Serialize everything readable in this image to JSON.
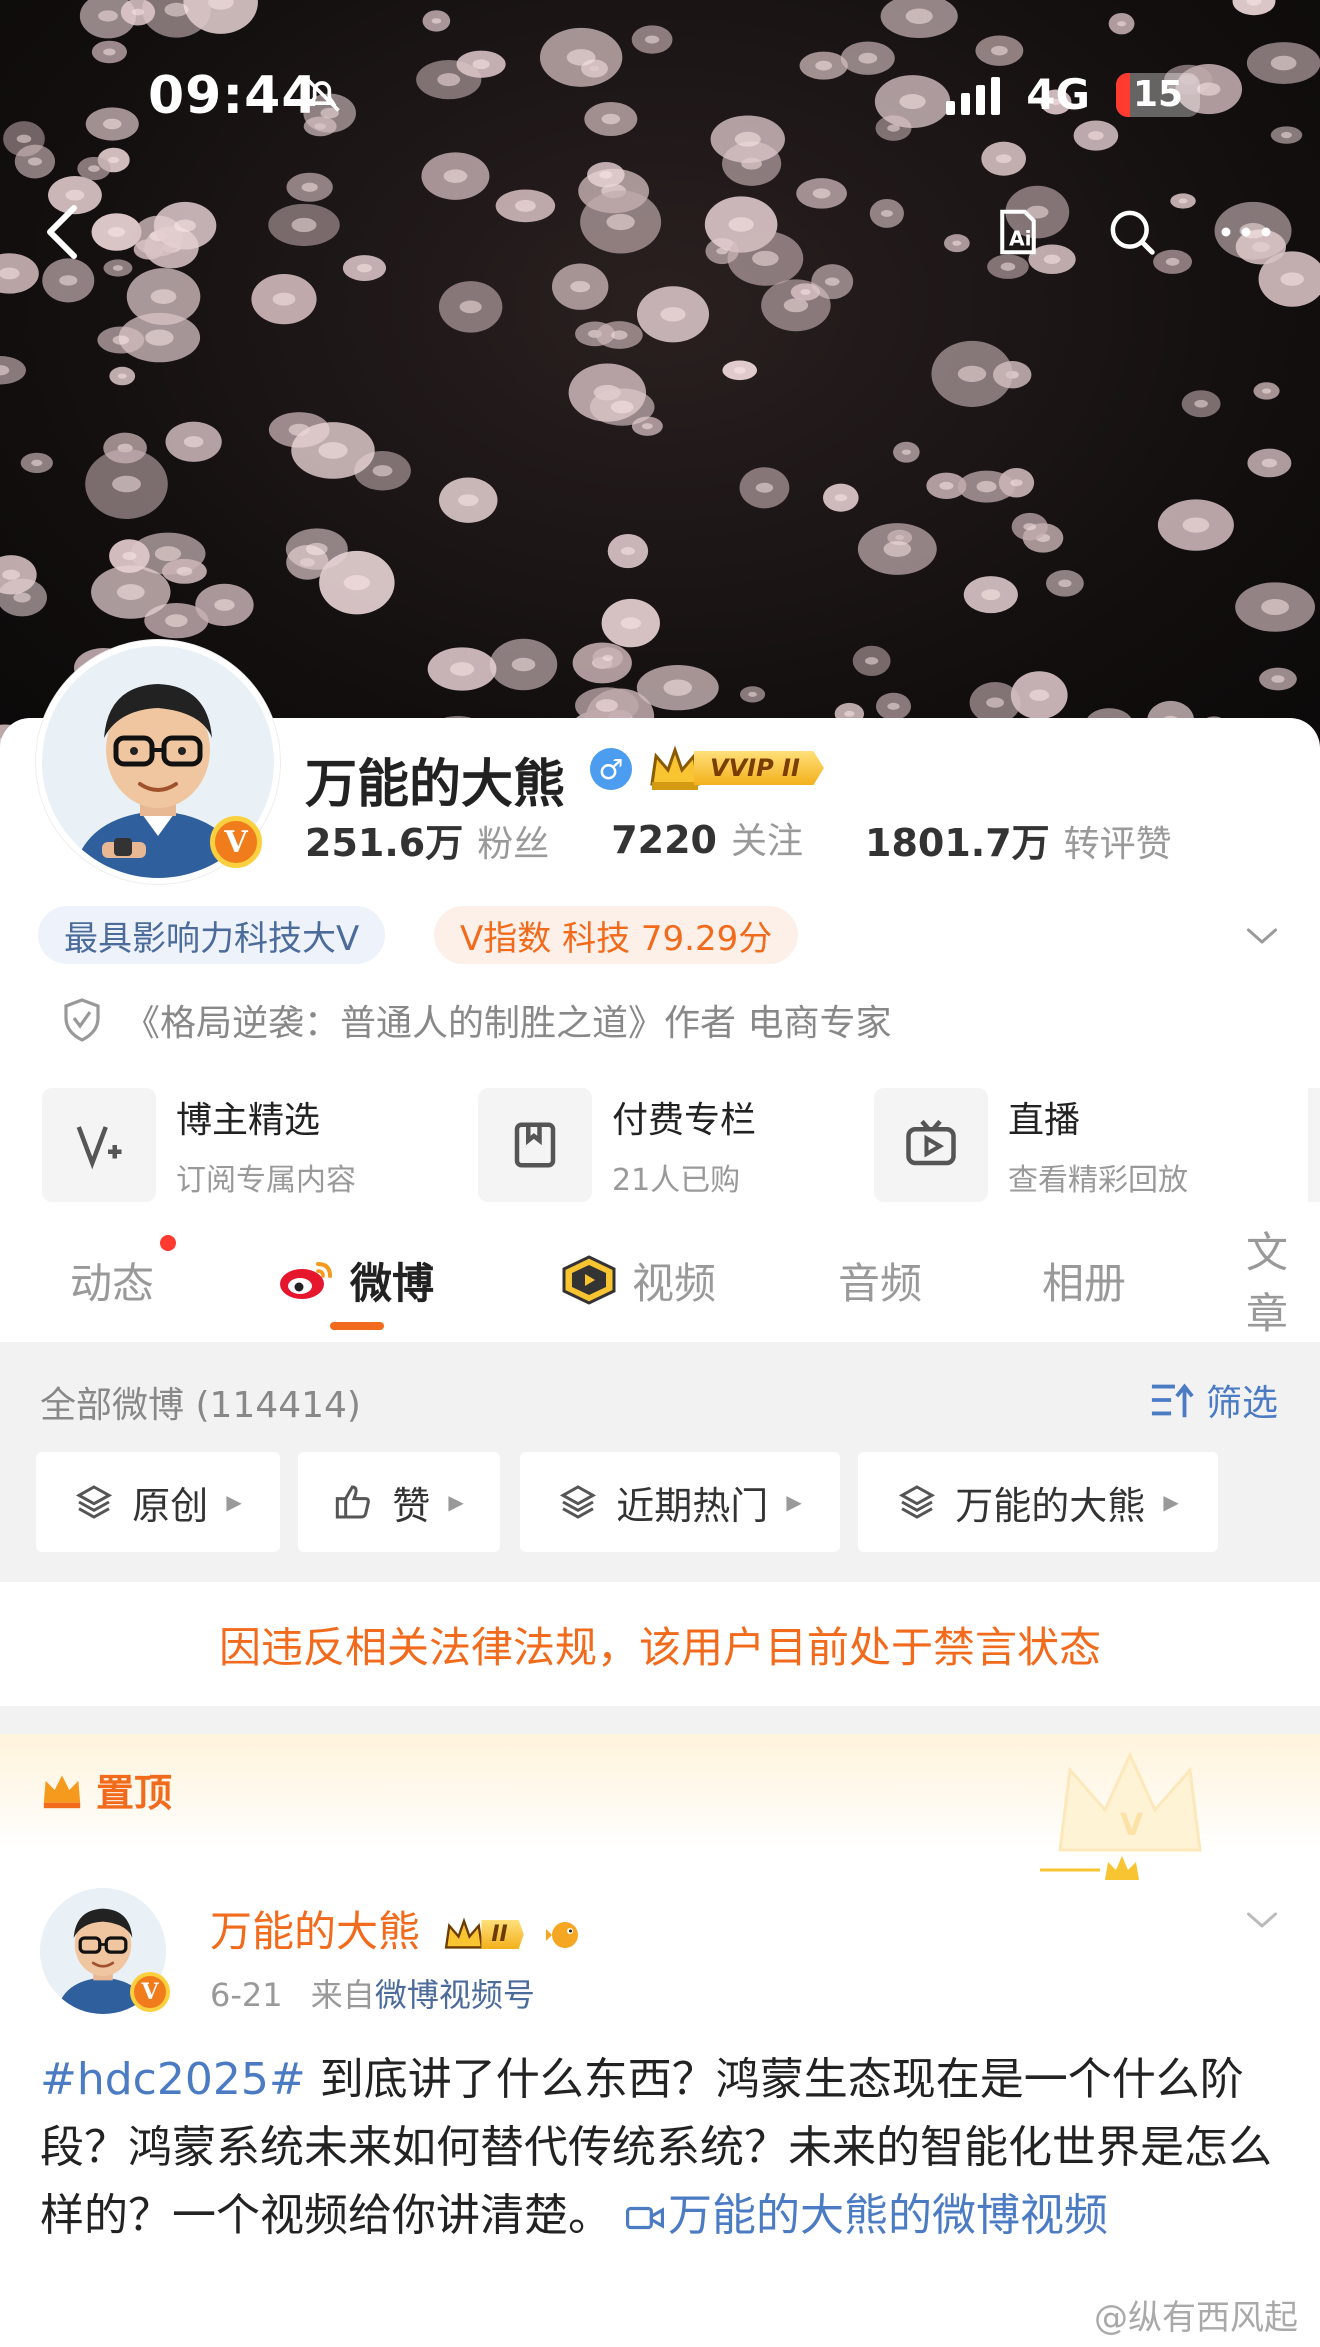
{
  "status_bar": {
    "time": "09:44",
    "network": "4G",
    "battery": "15"
  },
  "profile": {
    "name": "万能的大熊",
    "vip_label": "VVIP II",
    "stats": [
      {
        "value": "251.6万",
        "label": "粉丝"
      },
      {
        "value": "7220",
        "label": "关注"
      },
      {
        "value": "1801.7万",
        "label": "转评赞"
      }
    ],
    "tags": {
      "influence": "最具影响力科技大V",
      "v_index": "V指数 科技 79.29分"
    },
    "verification": "《格局逆袭：普通人的制胜之道》作者 电商专家",
    "avatar_badge": "V"
  },
  "services": [
    {
      "title": "博主精选",
      "subtitle": "订阅专属内容",
      "icon": "v-plus-icon"
    },
    {
      "title": "付费专栏",
      "subtitle": "21人已购",
      "icon": "bookmark-icon"
    },
    {
      "title": "直播",
      "subtitle": "查看精彩回放",
      "icon": "tv-play-icon"
    }
  ],
  "tabs": [
    "动态",
    "微博",
    "视频",
    "音频",
    "相册",
    "文章"
  ],
  "feed": {
    "all_label": "全部微博 (114414)",
    "filter_label": "筛选",
    "chips": [
      "原创",
      "赞",
      "近期热门",
      "万能的大熊"
    ]
  },
  "banned_notice": "因违反相关法律法规，该用户目前处于禁言状态",
  "pinned_label": "置顶",
  "post": {
    "author": "万能的大熊",
    "author_vip": "II",
    "date": "6-21",
    "source_prefix": "来自",
    "source": "微博视频号",
    "hashtag": "#hdc2025#",
    "text": " 到底讲了什么东西？鸿蒙生态现在是一个什么阶段？鸿蒙系统未来如何替代传统系统？未来的智能化世界是怎么样的？一个视频给你讲清楚。 ",
    "video_link": "万能的大熊的微博视频"
  },
  "watermark": "@纵有西风起",
  "colors": {
    "accent": "#f26a1b",
    "link": "#4b7bc2",
    "vip_gold": "#f3b01c",
    "gender_blue": "#4c9cf0"
  }
}
